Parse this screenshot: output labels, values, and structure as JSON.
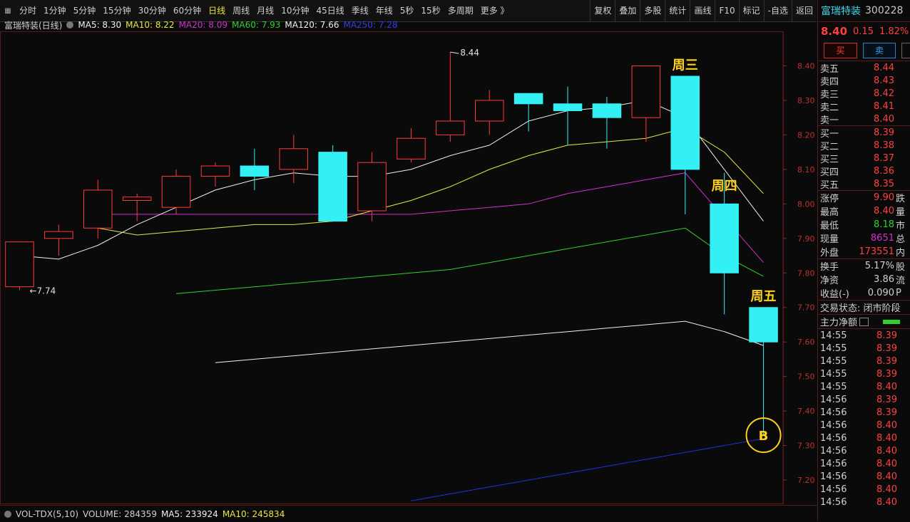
{
  "toolbar": {
    "periods": [
      "分时",
      "1分钟",
      "5分钟",
      "15分钟",
      "30分钟",
      "60分钟",
      "日线",
      "周线",
      "月线",
      "10分钟",
      "45日线",
      "季线",
      "年线",
      "5秒",
      "15秒",
      "多周期",
      "更多 》"
    ],
    "active_index": 6,
    "right_tools": [
      "复权",
      "叠加",
      "多股",
      "统计",
      "画线",
      "F10",
      "标记",
      "-自选",
      "返回"
    ]
  },
  "legend": {
    "stock": "富瑞特装(日线)",
    "ma5": "MA5: 8.30",
    "ma10": "MA10: 8.22",
    "ma20": "MA20: 8.09",
    "ma60": "MA60: 7.93",
    "ma120": "MA120: 7.66",
    "ma250": "MA250: 7.28"
  },
  "annotations": {
    "wed": "周三",
    "thu": "周四",
    "fri": "周五",
    "buy_marker": "B",
    "high_label": "8.44",
    "low_label": "7.74"
  },
  "colors": {
    "up": "#ff3a3a",
    "down": "#33f0f5",
    "ma5": "#f0f0f0",
    "ma10": "#e8e840",
    "ma20": "#d030d0",
    "ma60": "#30d030",
    "ma120": "#f0f0f0",
    "ma250": "#2030e0",
    "annotation": "#ffd21a"
  },
  "chart_data": {
    "type": "candlestick",
    "ylim": [
      7.13,
      8.5
    ],
    "y_ticks": [
      "8.40",
      "8.30",
      "8.20",
      "8.10",
      "8.00",
      "7.90",
      "7.80",
      "7.70",
      "7.60",
      "7.50",
      "7.40",
      "7.30",
      "7.20"
    ],
    "candles": [
      {
        "o": 7.76,
        "h": 7.89,
        "l": 7.75,
        "c": 7.89
      },
      {
        "o": 7.9,
        "h": 7.94,
        "l": 7.85,
        "c": 7.92
      },
      {
        "o": 7.93,
        "h": 8.07,
        "l": 7.9,
        "c": 8.04
      },
      {
        "o": 8.01,
        "h": 8.03,
        "l": 7.95,
        "c": 8.02
      },
      {
        "o": 7.99,
        "h": 8.1,
        "l": 7.97,
        "c": 8.08
      },
      {
        "o": 8.08,
        "h": 8.12,
        "l": 8.05,
        "c": 8.11
      },
      {
        "o": 8.11,
        "h": 8.16,
        "l": 8.04,
        "c": 8.08
      },
      {
        "o": 8.1,
        "h": 8.2,
        "l": 8.06,
        "c": 8.16
      },
      {
        "o": 8.15,
        "h": 8.17,
        "l": 7.95,
        "c": 7.95
      },
      {
        "o": 7.98,
        "h": 8.15,
        "l": 7.95,
        "c": 8.12
      },
      {
        "o": 8.13,
        "h": 8.22,
        "l": 8.12,
        "c": 8.19
      },
      {
        "o": 8.2,
        "h": 8.44,
        "l": 8.18,
        "c": 8.24
      },
      {
        "o": 8.24,
        "h": 8.33,
        "l": 8.2,
        "c": 8.3
      },
      {
        "o": 8.32,
        "h": 8.32,
        "l": 8.21,
        "c": 8.29
      },
      {
        "o": 8.29,
        "h": 8.34,
        "l": 8.17,
        "c": 8.27
      },
      {
        "o": 8.29,
        "h": 8.31,
        "l": 8.16,
        "c": 8.25
      },
      {
        "o": 8.25,
        "h": 8.4,
        "l": 8.18,
        "c": 8.4
      },
      {
        "o": 8.37,
        "h": 8.37,
        "l": 7.97,
        "c": 8.1
      },
      {
        "o": 8.0,
        "h": 8.09,
        "l": 7.68,
        "c": 7.8
      },
      {
        "o": 7.7,
        "h": 7.7,
        "l": 7.33,
        "c": 7.6
      }
    ],
    "ma5": [
      7.85,
      7.84,
      7.88,
      7.94,
      7.99,
      8.04,
      8.07,
      8.09,
      8.08,
      8.08,
      8.1,
      8.14,
      8.17,
      8.24,
      8.27,
      8.28,
      8.3,
      8.25,
      8.1,
      7.95
    ],
    "ma10": [
      7.93,
      7.91,
      7.92,
      7.93,
      7.94,
      7.94,
      7.95,
      7.98,
      8.01,
      8.05,
      8.1,
      8.14,
      8.17,
      8.18,
      8.19,
      8.22,
      8.15,
      8.03
    ],
    "ma20": [
      7.97,
      7.97,
      7.97,
      7.97,
      7.97,
      7.97,
      7.97,
      7.97,
      7.97,
      7.98,
      7.99,
      8.0,
      8.03,
      8.05,
      8.07,
      8.09,
      7.96,
      7.83
    ],
    "ma60": [
      7.74,
      7.75,
      7.76,
      7.77,
      7.78,
      7.79,
      7.8,
      7.81,
      7.83,
      7.85,
      7.87,
      7.89,
      7.91,
      7.93,
      7.85,
      7.79
    ],
    "ma120": [
      7.54,
      7.55,
      7.56,
      7.57,
      7.58,
      7.59,
      7.6,
      7.61,
      7.62,
      7.63,
      7.64,
      7.65,
      7.66,
      7.63,
      7.59
    ],
    "ma250": [
      7.14,
      7.16,
      7.18,
      7.2,
      7.22,
      7.24,
      7.26,
      7.28,
      7.3,
      7.32
    ]
  },
  "quote": {
    "name": "富瑞特装",
    "code": "300228",
    "price": "8.40",
    "change": "0.15",
    "change_pct": "1.82%",
    "buy_label": "买",
    "sell_label": "卖",
    "asks": [
      {
        "label": "卖五",
        "price": "8.44"
      },
      {
        "label": "卖四",
        "price": "8.43"
      },
      {
        "label": "卖三",
        "price": "8.42"
      },
      {
        "label": "卖二",
        "price": "8.41"
      },
      {
        "label": "卖一",
        "price": "8.40"
      }
    ],
    "bids": [
      {
        "label": "买一",
        "price": "8.39"
      },
      {
        "label": "买二",
        "price": "8.38"
      },
      {
        "label": "买三",
        "price": "8.37"
      },
      {
        "label": "买四",
        "price": "8.36"
      },
      {
        "label": "买五",
        "price": "8.35"
      }
    ],
    "stats1": [
      {
        "label": "涨停",
        "value": "9.90",
        "value_color": "#ff4040",
        "ext": "跌"
      },
      {
        "label": "最高",
        "value": "8.40",
        "value_color": "#ff4040",
        "ext": "量"
      },
      {
        "label": "最低",
        "value": "8.18",
        "value_color": "#30d030",
        "ext": "市"
      },
      {
        "label": "现量",
        "value": "8651",
        "value_color": "#d030d0",
        "ext": "总"
      },
      {
        "label": "外盘",
        "value": "173551",
        "value_color": "#ff4040",
        "ext": "内"
      }
    ],
    "stats2": [
      {
        "label": "换手",
        "value": "5.17%",
        "ext": "股"
      },
      {
        "label": "净资",
        "value": "3.86",
        "ext": "流"
      },
      {
        "label": "收益(-)",
        "value": "0.090",
        "ext": "P"
      }
    ],
    "trade_status": "交易状态: 闭市阶段",
    "main_flow_label": "主力净额",
    "trades": [
      {
        "time": "14:55",
        "price": "8.39"
      },
      {
        "time": "14:55",
        "price": "8.39"
      },
      {
        "time": "14:55",
        "price": "8.39"
      },
      {
        "time": "14:55",
        "price": "8.39"
      },
      {
        "time": "14:55",
        "price": "8.40"
      },
      {
        "time": "14:56",
        "price": "8.39"
      },
      {
        "time": "14:56",
        "price": "8.39"
      },
      {
        "time": "14:56",
        "price": "8.40"
      },
      {
        "time": "14:56",
        "price": "8.40"
      },
      {
        "time": "14:56",
        "price": "8.40"
      },
      {
        "time": "14:56",
        "price": "8.40"
      },
      {
        "time": "14:56",
        "price": "8.40"
      },
      {
        "time": "14:56",
        "price": "8.40"
      },
      {
        "time": "14:56",
        "price": "8.40"
      }
    ]
  },
  "volume": {
    "name": "VOL-TDX(5,10)",
    "volume": "VOLUME: 284359",
    "ma5": "MA5: 233924",
    "ma10": "MA10: 245834"
  }
}
